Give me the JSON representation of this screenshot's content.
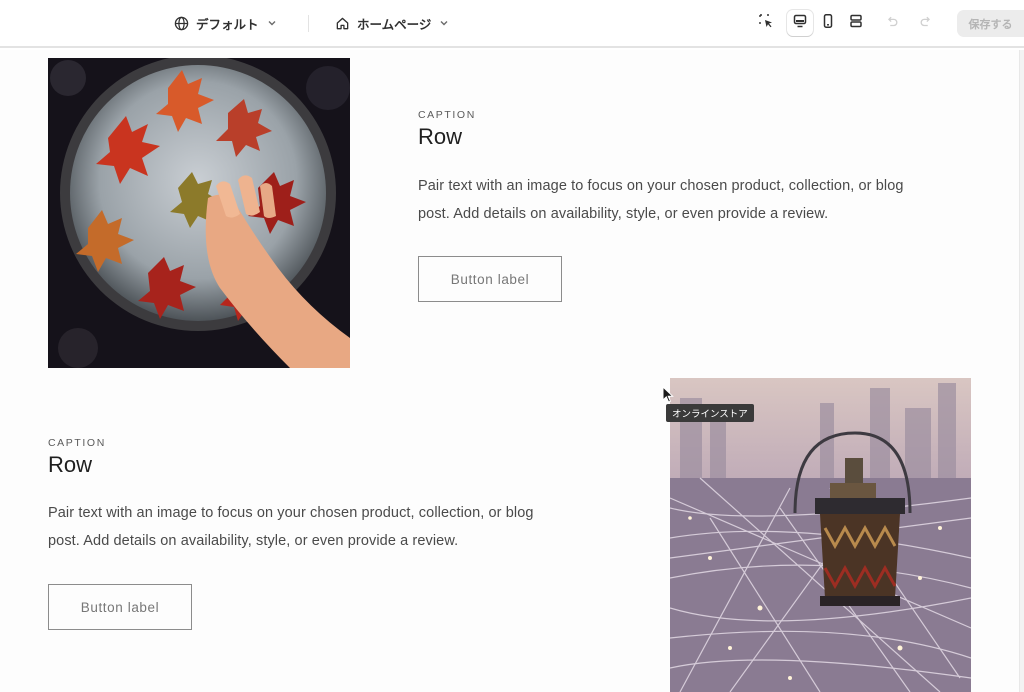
{
  "toolbar": {
    "theme_label": "デフォルト",
    "page_label": "ホームページ",
    "save_label": "保存する",
    "icons": [
      "globe-icon",
      "chevron-down-icon",
      "home-icon",
      "select-element-icon",
      "desktop-icon",
      "mobile-icon",
      "fullscreen-icon",
      "undo-icon",
      "redo-icon"
    ],
    "active_view": "desktop"
  },
  "rows": [
    {
      "caption": "CAPTION",
      "heading": "Row",
      "body_line1": "Pair text with an image to focus on your chosen product, collection, or blog",
      "body_line2": "post. Add details on availability, style, or even provide a review.",
      "button_label": "Button label",
      "image": "autumn-leaves-tray-image"
    },
    {
      "caption": "CAPTION",
      "heading": "Row",
      "body_line1": "Pair text with an image to focus on your chosen product, collection, or blog",
      "body_line2": "post. Add details on availability, style, or even provide a review.",
      "button_label": "Button label",
      "image": "lantern-city-image"
    }
  ],
  "tooltip": "オンラインストア",
  "colors": {
    "save_disabled_bg": "#ececec",
    "save_disabled_text": "#b5b5b5",
    "tooltip_bg": "#3a3a3a"
  }
}
